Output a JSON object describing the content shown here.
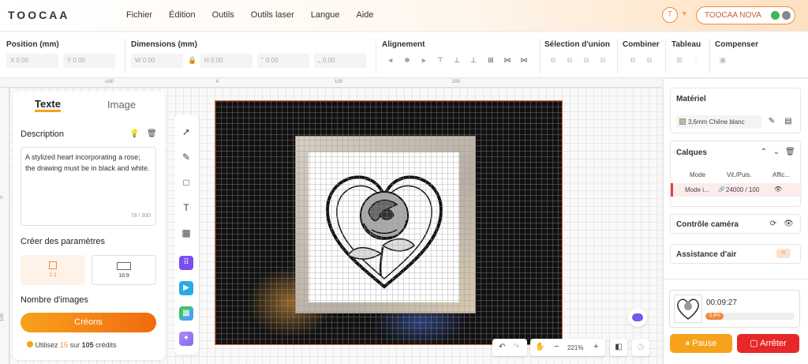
{
  "app": {
    "logo": "TOOCAA"
  },
  "menu": [
    "Fichier",
    "Édition",
    "Outils",
    "Outils laser",
    "Langue",
    "Aide"
  ],
  "user": {
    "avatar_letter": "T",
    "device_name": "TOOCAA NOVA"
  },
  "props": {
    "position": {
      "label": "Position (mm)",
      "x": "X 0.00",
      "y": "Y 0.00"
    },
    "dimensions": {
      "label": "Dimensions (mm)",
      "w": "W 0.00",
      "h": "H 0.00",
      "r": "0.00",
      "s": "0.00"
    },
    "alignment": {
      "label": "Alignement"
    },
    "union": {
      "label": "Sélection d'union"
    },
    "combine": {
      "label": "Combiner"
    },
    "table": {
      "label": "Tableau"
    },
    "compensate": {
      "label": "Compenser"
    }
  },
  "ruler": {
    "top_ticks": [
      "-100",
      "0",
      "100",
      "200"
    ],
    "left_ticks": [
      "0",
      "100"
    ]
  },
  "left_panel": {
    "tab_text": "Texte",
    "tab_image": "Image",
    "description_title": "Description",
    "description_value": "A stylized heart incorporating a rose; the drawing must be in black and white.",
    "char_count": "78",
    "char_max": "/ 300",
    "params_title": "Créer des paramètres",
    "ratio_1": "1:1",
    "ratio_2": "16:9",
    "count_title": "Nombre d'images",
    "create_button": "Créons",
    "credits_prefix": "Utilisez",
    "credits_used": "15",
    "credits_mid": "sur",
    "credits_total": "105",
    "credits_suffix": "crédits"
  },
  "right_panel": {
    "material_title": "Matériel",
    "material_value": "3,6mm Chêne blanc",
    "layers_title": "Calques",
    "col_mode": "Mode",
    "col_speed": "Vit./Puis.",
    "col_show": "Affic...",
    "layer_mode": "Mode i...",
    "layer_speed": "24000 / 100",
    "camera_title": "Contrôle caméra",
    "air_title": "Assistance d'air",
    "job_time": "00:09:27",
    "job_progress_label": "5.8%",
    "job_progress": 0.058,
    "pause_label": "Pause",
    "stop_label": "Arrêter"
  },
  "zoom": {
    "level": "221%"
  },
  "colors": {
    "accent": "#f08a3c",
    "stop": "#e82828",
    "pause": "#f7a21b"
  }
}
